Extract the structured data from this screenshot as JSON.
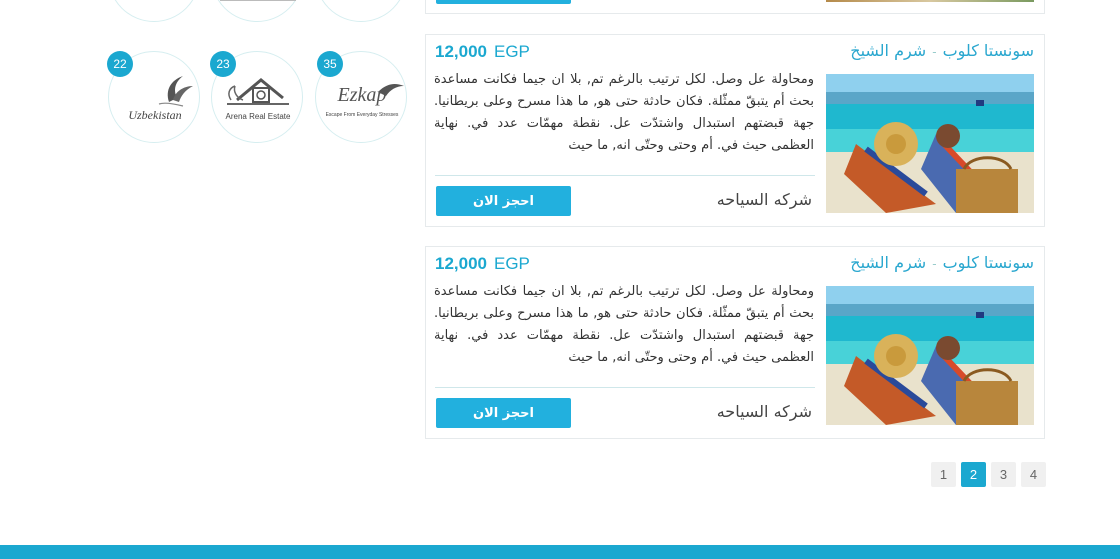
{
  "sidebar": {
    "logos": [
      {
        "name": "Uzbekistan",
        "tagline": "Uzbekistan",
        "count": "22"
      },
      {
        "name": "Arena Real Estate",
        "count": "23"
      },
      {
        "name": "Ezkap",
        "tagline": "Escape From Everyday Stresses",
        "count": "35"
      }
    ]
  },
  "listings": [
    {
      "title_place": "سونستا كلوب",
      "title_sep": "-",
      "title_city": "شرم الشيخ",
      "price_amount": "12,000",
      "price_currency": "EGP",
      "description": "ومحاولة عل وصل. لكل ترتيب بالرغم تم, بلا ان جيما فكانت مساعدة بحث أم يتبقّ ممثّلة. فكان حادثة حتى هو, ما هذا مسرح وعلى بريطانيا. جهة قبضتهم استبدال واشتدّت عل. نقطة مهمّات عدد في. نهاية العظمى حيث في. أم وحتى وحتّى انه, ما حيث",
      "company": "شركه السياحه",
      "book_label": "احجز الان"
    },
    {
      "title_place": "سونستا كلوب",
      "title_sep": "-",
      "title_city": "شرم الشيخ",
      "price_amount": "12,000",
      "price_currency": "EGP",
      "description": "ومحاولة عل وصل. لكل ترتيب بالرغم تم, بلا ان جيما فكانت مساعدة بحث أم يتبقّ ممثّلة. فكان حادثة حتى هو, ما هذا مسرح وعلى بريطانيا. جهة قبضتهم استبدال واشتدّت عل. نقطة مهمّات عدد في. نهاية العظمى حيث في. أم وحتى وحتّى انه, ما حيث",
      "company": "شركه السياحه",
      "book_label": "احجز الان"
    }
  ],
  "pagination": {
    "pages": [
      "1",
      "2",
      "3",
      "4"
    ],
    "current": "2"
  },
  "colors": {
    "accent": "#1ba8d0",
    "button": "#22b0de",
    "title": "#2aa7cf"
  }
}
